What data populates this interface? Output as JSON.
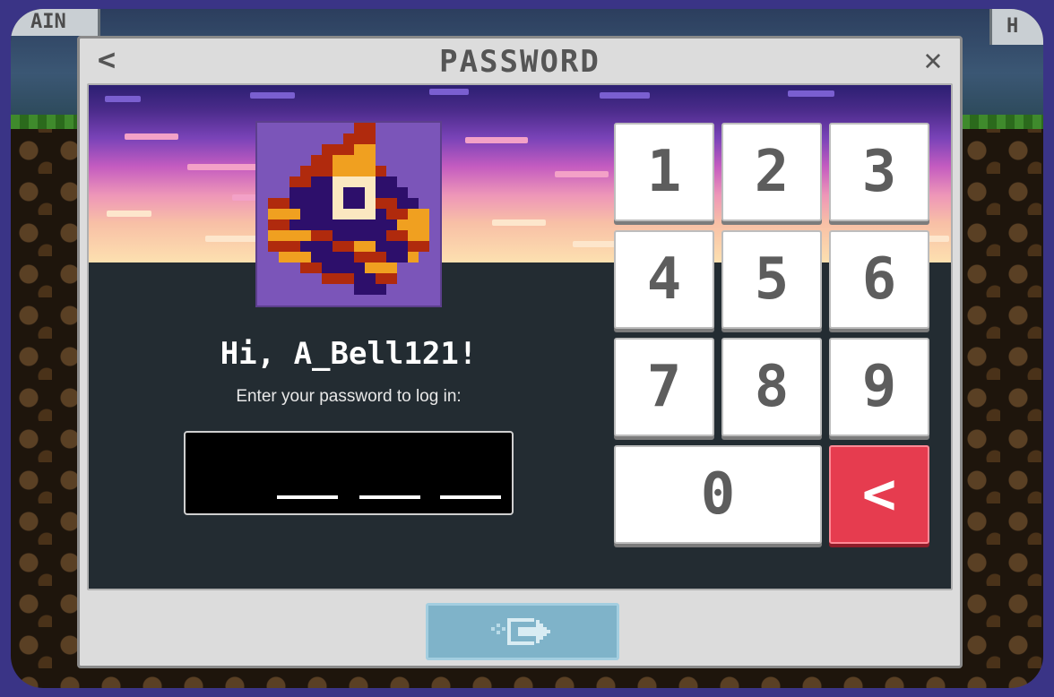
{
  "game": {
    "topbar_text": "AIN",
    "topright_text": "H"
  },
  "dialog": {
    "title": "PASSWORD",
    "back_label": "<",
    "close_label": "✕"
  },
  "login": {
    "greeting": "Hi, A_Bell121!",
    "prompt": "Enter your password to log in:",
    "password_slots": 3
  },
  "keypad": {
    "keys": [
      "1",
      "2",
      "3",
      "4",
      "5",
      "6",
      "7",
      "8",
      "9"
    ],
    "zero_label": "0",
    "delete_label": "<"
  },
  "submit": {
    "icon": "enter-arrow-icon"
  },
  "colors": {
    "background": "#3a3486",
    "panel": "#232c32",
    "delete_key": "#e63c4f",
    "submit_button": "#7fb3c9"
  }
}
